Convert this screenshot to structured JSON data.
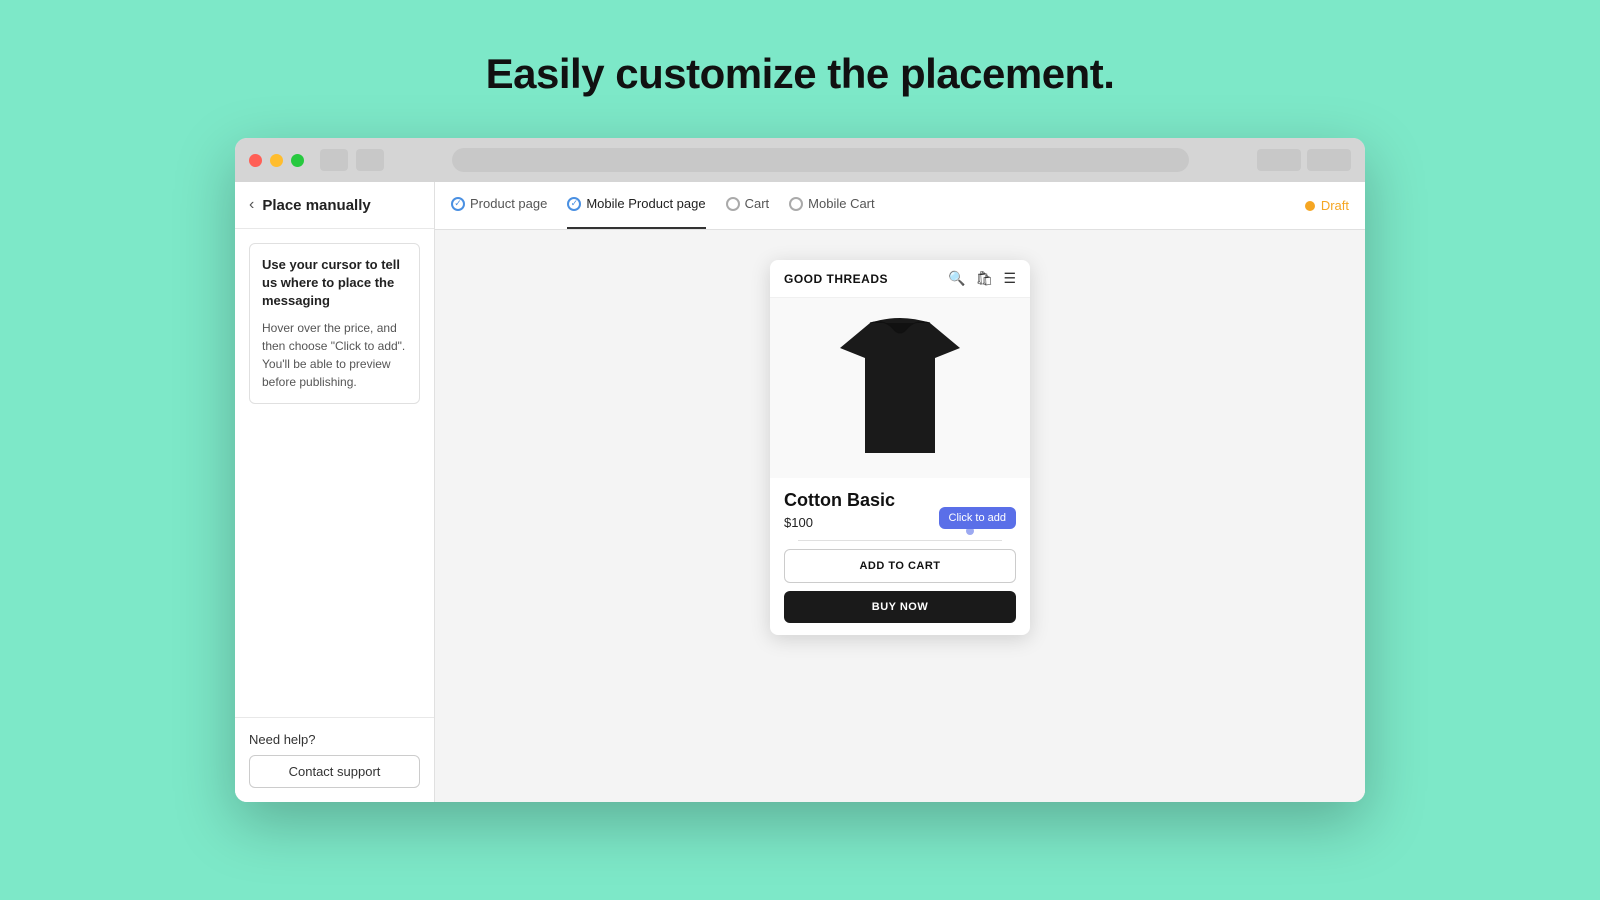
{
  "page": {
    "heading": "Easily customize the placement."
  },
  "titlebar": {
    "traffic_lights": [
      "red",
      "yellow",
      "green"
    ]
  },
  "sidebar": {
    "back_label": "‹",
    "title": "Place manually",
    "info_title": "Use your cursor to tell us where to place the messaging",
    "info_desc": "Hover over the price, and then choose \"Click to add\". You'll be able to preview before publishing.",
    "need_help_label": "Need help?",
    "contact_btn_label": "Contact support"
  },
  "tabs": [
    {
      "label": "Product page",
      "active": false,
      "check": "done"
    },
    {
      "label": "Mobile Product page",
      "active": true,
      "check": "done"
    },
    {
      "label": "Cart",
      "active": false,
      "check": "none"
    },
    {
      "label": "Mobile Cart",
      "active": false,
      "check": "none"
    }
  ],
  "draft": {
    "label": "Draft"
  },
  "product": {
    "store_name": "GOOD THREADS",
    "name": "Cotton Basic",
    "price": "$100",
    "click_to_add_label": "Click to add",
    "add_to_cart_label": "ADD TO CART",
    "buy_now_label": "BUY NOW"
  }
}
